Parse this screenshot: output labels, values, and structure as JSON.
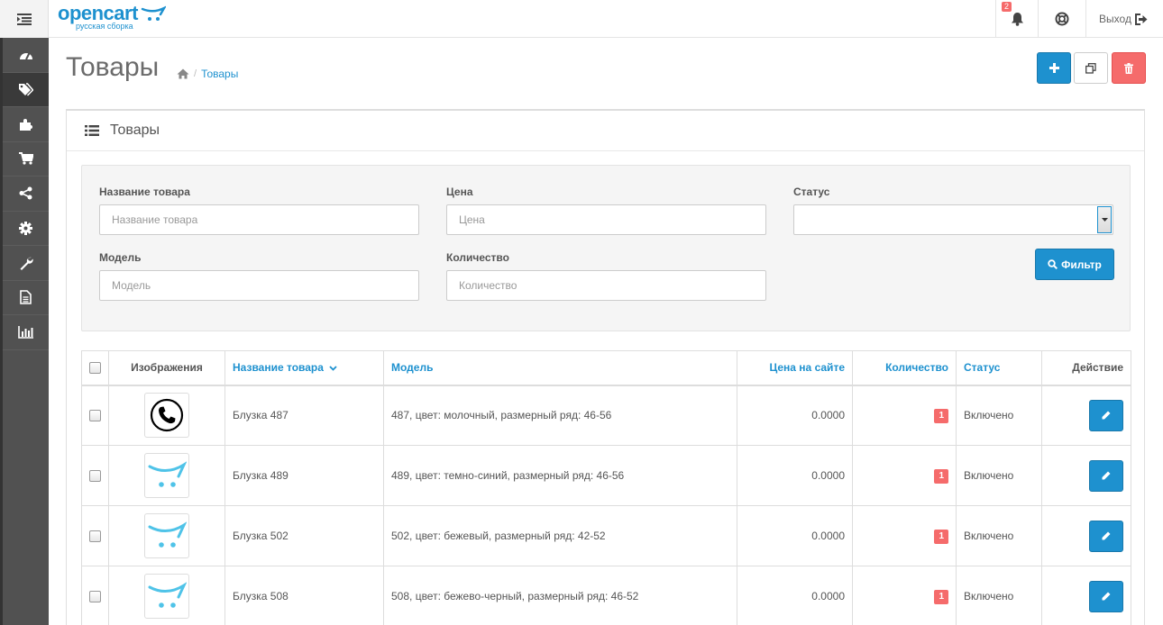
{
  "header": {
    "logo_text": "opencart",
    "logo_subtitle": "русская сборка",
    "notifications_count": "2",
    "logout_label": "Выход"
  },
  "sidebar": {
    "items": [
      {
        "icon": "dashboard-icon"
      },
      {
        "icon": "tags-icon",
        "active": true
      },
      {
        "icon": "puzzle-icon"
      },
      {
        "icon": "shopping-cart-icon"
      },
      {
        "icon": "share-icon"
      },
      {
        "icon": "gear-icon"
      },
      {
        "icon": "wrench-icon"
      },
      {
        "icon": "document-icon"
      },
      {
        "icon": "bar-chart-icon"
      }
    ]
  },
  "page": {
    "title": "Товары",
    "breadcrumb": [
      {
        "icon": "home-icon"
      },
      {
        "label": "Товары"
      }
    ]
  },
  "panel": {
    "title": "Товары"
  },
  "filter": {
    "name_label": "Название товара",
    "name_placeholder": "Название товара",
    "price_label": "Цена",
    "price_placeholder": "Цена",
    "status_label": "Статус",
    "status_value": "",
    "model_label": "Модель",
    "model_placeholder": "Модель",
    "quantity_label": "Количество",
    "quantity_placeholder": "Количество",
    "filter_button": "Фильтр"
  },
  "table": {
    "columns": {
      "image": "Изображения",
      "name": "Название товара",
      "model": "Модель",
      "price": "Цена на сайте",
      "quantity": "Количество",
      "status": "Статус",
      "action": "Действие"
    },
    "rows": [
      {
        "image": "phone-icon",
        "name": "Блузка 487",
        "model": "487, цвет: молочный, размерный ряд: 46-56",
        "price": "0.0000",
        "quantity": "1",
        "status": "Включено"
      },
      {
        "image": "opencart-cart-icon",
        "name": "Блузка 489",
        "model": "489, цвет: темно-синий, размерный ряд: 46-56",
        "price": "0.0000",
        "quantity": "1",
        "status": "Включено"
      },
      {
        "image": "opencart-cart-icon",
        "name": "Блузка 502",
        "model": "502, цвет: бежевый, размерный ряд: 42-52",
        "price": "0.0000",
        "quantity": "1",
        "status": "Включено"
      },
      {
        "image": "opencart-cart-icon",
        "name": "Блузка 508",
        "model": "508, цвет: бежево-черный, размерный ряд: 46-52",
        "price": "0.0000",
        "quantity": "1",
        "status": "Включено"
      }
    ]
  },
  "colors": {
    "primary": "#1e91cf",
    "danger": "#f56b6b",
    "sidebar": "#515151"
  }
}
